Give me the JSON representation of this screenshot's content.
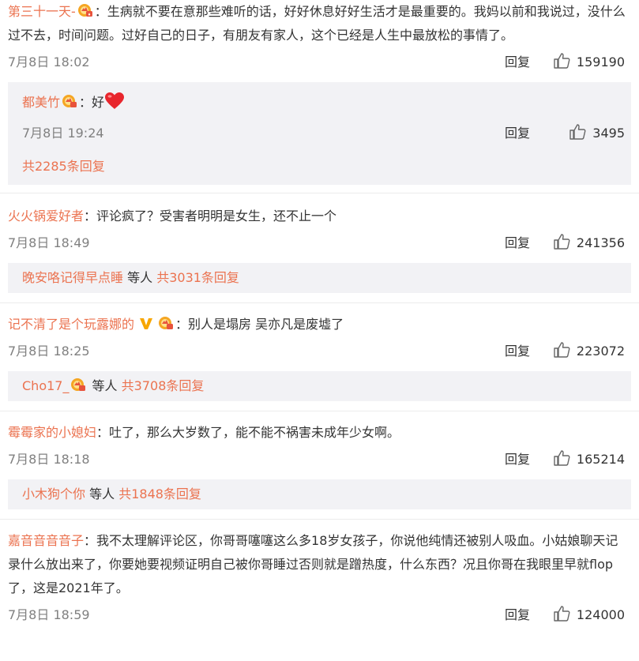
{
  "comments": [
    {
      "user": "第三十一天-",
      "sep": "：",
      "text": "生病就不要在意那些难听的话，好好休息好好生活才是最重要的。我妈以前和我说过，没什么过不去，时间问题。过好自己的日子，有朋友有家人，这个已经是人生中最放松的事情了。",
      "time": "7月8日 18:02",
      "reply": "回复",
      "likes": "159190",
      "sub": {
        "user": "都美竹",
        "sep": "：",
        "text": "好",
        "time": "7月8日 19:24",
        "reply": "回复",
        "likes": "3495",
        "more": "共2285条回复"
      }
    },
    {
      "user": "火火锅爱好者",
      "sep": "：",
      "text": "评论疯了？受害者明明是女生，还不止一个",
      "time": "7月8日 18:49",
      "reply": "回复",
      "likes": "241356",
      "summary": {
        "user": "晚安咯记得早点睡",
        "mid": " 等人 ",
        "count": "共3031条回复"
      }
    },
    {
      "user": "记不清了是个玩露娜的",
      "sep": "：",
      "text": "别人是塌房 吴亦凡是废墟了",
      "time": "7月8日 18:25",
      "reply": "回复",
      "likes": "223072",
      "summary": {
        "user": "Cho17_",
        "mid": " 等人 ",
        "count": "共3708条回复"
      }
    },
    {
      "user": "霉霉家的小媳妇",
      "sep": "：",
      "text": "吐了，那么大岁数了，能不能不祸害未成年少女啊。",
      "time": "7月8日 18:18",
      "reply": "回复",
      "likes": "165214",
      "summary": {
        "user": "小木狗个你",
        "mid": " 等人 ",
        "count": "共1848条回复"
      }
    },
    {
      "user": "嘉音音音音子",
      "sep": "：",
      "text": "我不太理解评论区，你哥哥噻噻这么多18岁女孩子，你说他纯情还被别人吸血。小姑娘聊天记录什么放出来了，你要她要视频证明自己被你哥睡过否则就是蹭热度，什么东西？况且你哥在我眼里早就flop了，这是2021年了。",
      "time": "7月8日 18:59",
      "reply": "回复",
      "likes": "124000"
    }
  ],
  "colors": {
    "username": "#eb7350",
    "subBg": "#f2f2f5",
    "meta": "#808080"
  },
  "icons": {
    "badge": "fan-badge-icon",
    "v": "v-verified-icon",
    "heart": "red-heart-emoji",
    "thumb": "thumbs-up-icon"
  }
}
